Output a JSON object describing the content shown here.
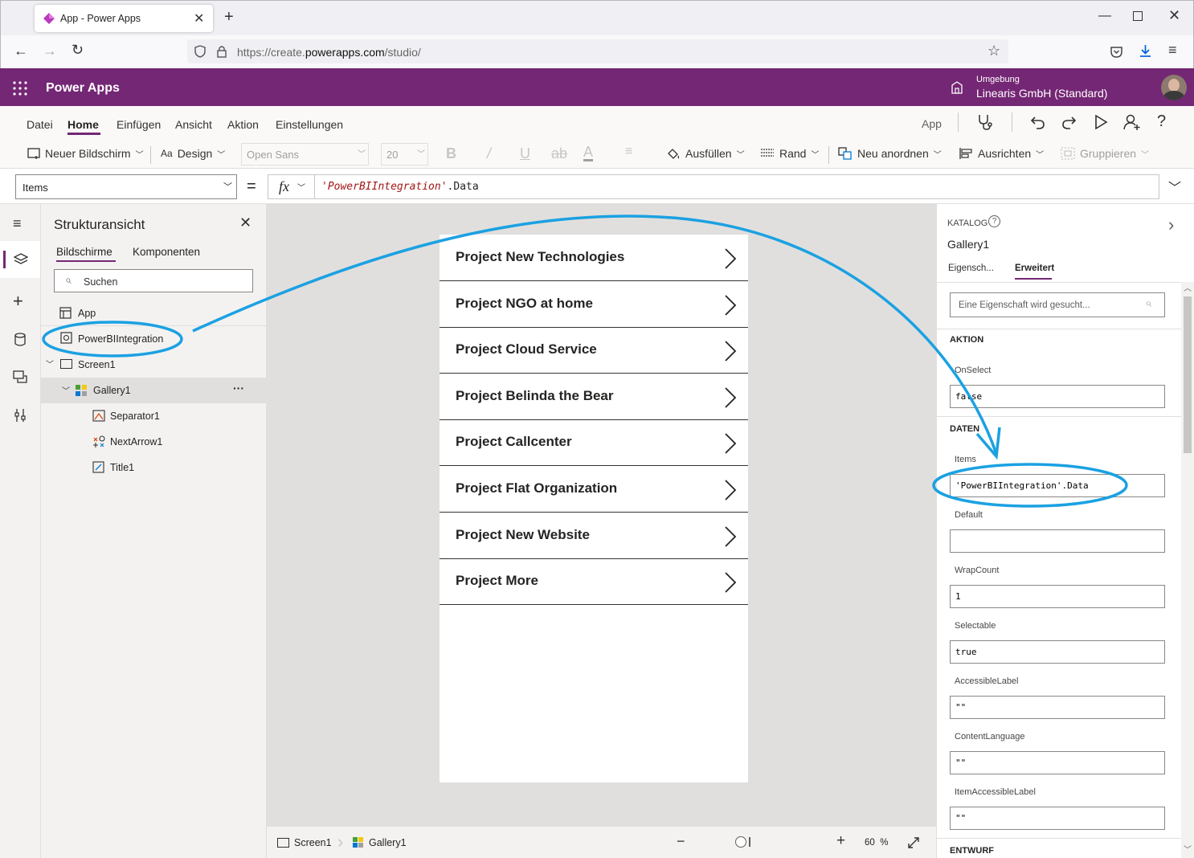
{
  "browser": {
    "tab_title": "App - Power Apps",
    "url_prefix": "https://create.",
    "url_domain": "powerapps.com",
    "url_path": "/studio/"
  },
  "header": {
    "app_name": "Power Apps",
    "env_label": "Umgebung",
    "env_name": "Linearis GmbH (Standard)",
    "brand_color": "#742774"
  },
  "menu": {
    "items": [
      "Datei",
      "Home",
      "Einfügen",
      "Ansicht",
      "Aktion",
      "Einstellungen"
    ],
    "active": "Home",
    "app_label": "App"
  },
  "ribbon": {
    "new_screen": "Neuer Bildschirm",
    "design": "Design",
    "font": "Open Sans",
    "font_size": "20",
    "fill": "Ausfüllen",
    "border": "Rand",
    "reorder": "Neu anordnen",
    "align": "Ausrichten",
    "group": "Gruppieren"
  },
  "formula": {
    "property": "Items",
    "equals": "=",
    "fx": "fx",
    "value_quoted": "'PowerBIIntegration'",
    "value_rest": ".Data"
  },
  "tree": {
    "title": "Strukturansicht",
    "tab_screens": "Bildschirme",
    "tab_components": "Komponenten",
    "search_placeholder": "Suchen",
    "app": "App",
    "datasource": "PowerBIIntegration",
    "screen": "Screen1",
    "gallery": "Gallery1",
    "more": "···",
    "children": [
      "Separator1",
      "NextArrow1",
      "Title1"
    ]
  },
  "gallery": {
    "items": [
      "Project New Technologies",
      "Project NGO at home",
      "Project Cloud Service",
      "Project Belinda the Bear",
      "Project Callcenter",
      "Project Flat Organization",
      "Project New Website",
      "Project More"
    ]
  },
  "status": {
    "screen": "Screen1",
    "gallery": "Gallery1",
    "zoom_value": "60",
    "zoom_unit": "%"
  },
  "properties": {
    "catalog_label": "KATALOG",
    "control_name": "Gallery1",
    "tab_props": "Eigensch...",
    "tab_advanced": "Erweitert",
    "search_placeholder": "Eine Eigenschaft wird gesucht...",
    "section_action": "AKTION",
    "onselect_label": "OnSelect",
    "onselect_value": "false",
    "section_data": "DATEN",
    "items_label": "Items",
    "items_value": "'PowerBIIntegration'.Data",
    "default_label": "Default",
    "default_value": "",
    "wrapcount_label": "WrapCount",
    "wrapcount_value": "1",
    "selectable_label": "Selectable",
    "selectable_value": "true",
    "accessible_label": "AccessibleLabel",
    "accessible_value": "\"\"",
    "contentlang_label": "ContentLanguage",
    "contentlang_value": "\"\"",
    "itemaccessible_label": "ItemAccessibleLabel",
    "itemaccessible_value": "\"\"",
    "section_design": "ENTWURF"
  },
  "annotation_color": "#1ba1e2"
}
